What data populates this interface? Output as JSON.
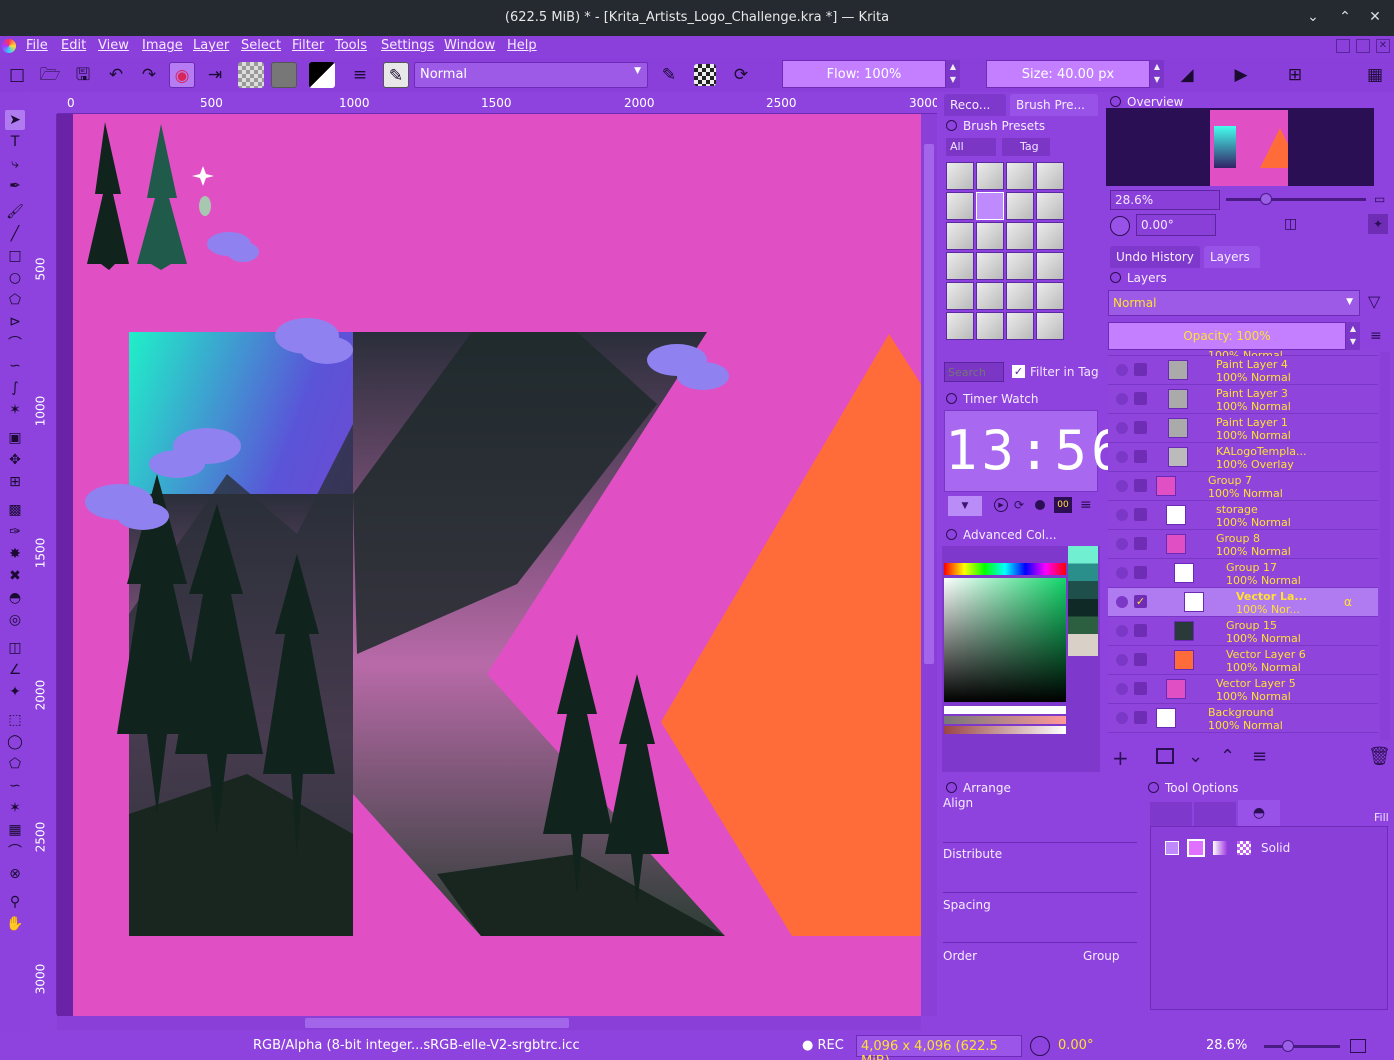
{
  "window": {
    "title": "(622.5 MiB)  * - [Krita_Artists_Logo_Challenge.kra *] — Krita"
  },
  "menu": [
    "File",
    "Edit",
    "View",
    "Image",
    "Layer",
    "Select",
    "Filter",
    "Tools",
    "Settings",
    "Window",
    "Help"
  ],
  "toolbar": {
    "blend_mode": "Normal",
    "flow": "Flow: 100%",
    "size": "Size: 40.00 px"
  },
  "ruler": {
    "h_labels": [
      "0",
      "500",
      "1000",
      "1500",
      "2000",
      "2500",
      "3000"
    ],
    "v_labels": [
      "500",
      "1000",
      "1500",
      "2000",
      "2500",
      "3000"
    ]
  },
  "dock_tabs": [
    "Reco...",
    "Brush Pre..."
  ],
  "brush_presets": {
    "title": "Brush Presets",
    "filter": "All",
    "tag": "Tag",
    "search_placeholder": "Search",
    "filter_in_tag": "Filter in Tag"
  },
  "timer_watch": {
    "title": "Timer Watch",
    "time": "13:56",
    "mode": "00"
  },
  "advanced_color": {
    "title": "Advanced Col..."
  },
  "arrange": {
    "title": "Arrange",
    "align": "Align",
    "distribute": "Distribute",
    "spacing": "Spacing",
    "order": "Order",
    "group": "Group"
  },
  "overview": {
    "title": "Overview",
    "zoom": "28.6%",
    "rotation": "0.00°"
  },
  "right_tabs": [
    "Undo History",
    "Layers"
  ],
  "layers": {
    "title": "Layers",
    "blend": "Normal",
    "opacity": "Opacity:  100%",
    "rows": [
      {
        "name": "",
        "props": "100% Normal"
      },
      {
        "name": "Paint Layer 4",
        "props": "100% Normal"
      },
      {
        "name": "Paint Layer 3",
        "props": "100% Normal"
      },
      {
        "name": "Paint Layer 1",
        "props": "100% Normal"
      },
      {
        "name": "KALogoTempla...",
        "props": "100% Overlay"
      },
      {
        "name": "Group 7",
        "props": "100% Normal"
      },
      {
        "name": "storage",
        "props": "100% Normal"
      },
      {
        "name": "Group 8",
        "props": "100% Normal"
      },
      {
        "name": "Group 17",
        "props": "100% Normal"
      },
      {
        "name": "Vector La...",
        "props": "100% Nor..."
      },
      {
        "name": "Group 15",
        "props": "100% Normal"
      },
      {
        "name": "Vector Layer 6",
        "props": "100% Normal"
      },
      {
        "name": "Vector Layer 5",
        "props": "100% Normal"
      },
      {
        "name": "Background",
        "props": "100% Normal"
      }
    ]
  },
  "tool_options": {
    "title": "Tool Options",
    "tab_label": "Fill",
    "fill_type": "Solid"
  },
  "status": {
    "colorspace": "RGB/Alpha (8-bit integer...sRGB-elle-V2-srgbtrc.icc",
    "rec": "REC",
    "dimensions": "4,096 x 4,096 (622.5 MiB)",
    "rotation": "0.00°",
    "zoom": "28.6%"
  },
  "colors": {
    "bg_purple": "#8e43de",
    "canvas_pink": "#e04fc4",
    "orange": "#ff6c3a",
    "layer_text": "#ffe033"
  }
}
